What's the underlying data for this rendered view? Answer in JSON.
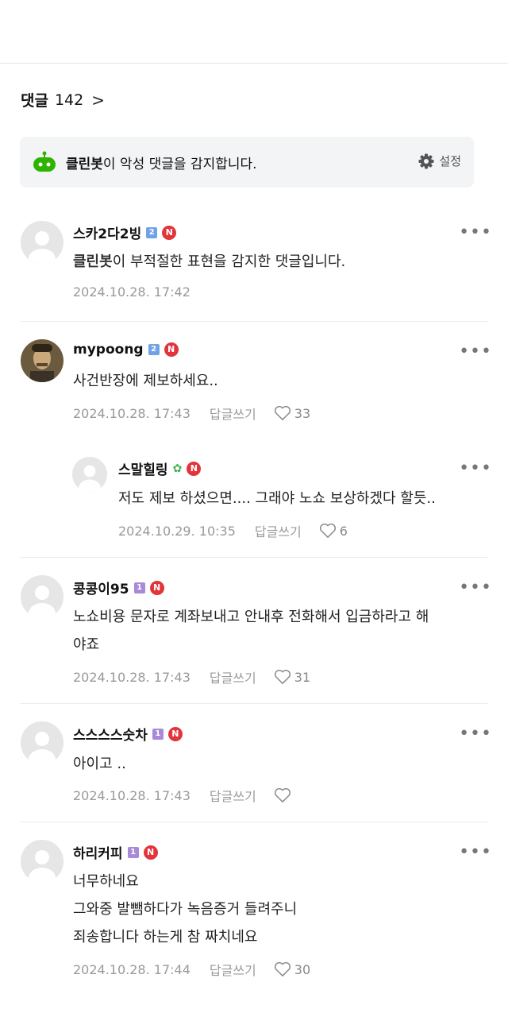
{
  "header": {
    "title": "댓글",
    "count": "142",
    "chevron": ">"
  },
  "banner": {
    "bot_name": "클린봇",
    "text": "이 악성 댓글을 감지합니다.",
    "settings_label": "설정",
    "icon": "gear-icon",
    "accent": "#2db400"
  },
  "more_label": "•••",
  "reply_label": "답글쓰기",
  "comments": [
    {
      "name": "스카2다2빙",
      "level": "2",
      "body_bot": "클린봇",
      "body": "이 부적절한 표현을 감지한 댓글입니다.",
      "date": "2024.10.28. 17:42"
    },
    {
      "name": "mypoong",
      "level": "2",
      "body": "사건반장에 제보하세요..",
      "date": "2024.10.28. 17:43",
      "likes": "33"
    },
    {
      "name": "스말힐링",
      "level": "sprout",
      "body": "저도 제보 하셨으면.... 그래야 노쇼 보상하겠다 할듯..",
      "date": "2024.10.29. 10:35",
      "likes": "6"
    },
    {
      "name": "콩콩이95",
      "level": "1",
      "body": "노쇼비용 문자로 계좌보내고 안내후 전화해서 입금하라고 해\n야죠",
      "date": "2024.10.28. 17:43",
      "likes": "31"
    },
    {
      "name": "스스스스숫차",
      "level": "1",
      "body": "아이고 ..",
      "date": "2024.10.28. 17:43",
      "likes": ""
    },
    {
      "name": "하리커피",
      "level": "1",
      "body": "너무하네요\n그와중 발뺌하다가 녹음증거 들려주니\n죄송합니다 하는게 참 짜치네요",
      "date": "2024.10.28. 17:44",
      "likes": "30"
    }
  ],
  "badge_n": "N"
}
